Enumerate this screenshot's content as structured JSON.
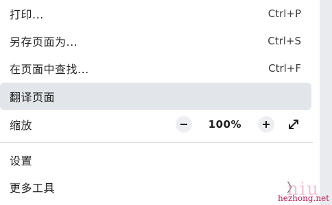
{
  "menu": {
    "print": {
      "label": "打印...",
      "shortcut": "Ctrl+P"
    },
    "save_as": {
      "label": "另存页面为...",
      "shortcut": "Ctrl+S"
    },
    "find": {
      "label": "在页面中查找...",
      "shortcut": "Ctrl+F"
    },
    "translate": {
      "label": "翻译页面"
    },
    "zoom": {
      "label": "缩放",
      "out": "−",
      "value": "100%",
      "in": "+"
    },
    "settings": {
      "label": "设置"
    },
    "more_tools": {
      "label": "更多工具",
      "chevron": "〉"
    }
  },
  "watermark": {
    "big": "niu",
    "small": "hezhong.net"
  },
  "icons": {
    "zoom_out": "minus-icon",
    "zoom_in": "plus-icon",
    "fullscreen": "fullscreen-icon",
    "submenu": "chevron-right-icon"
  },
  "colors": {
    "highlight": "#e2e5ea",
    "divider": "#dadce0",
    "scrollbar_track": "#e9ebee",
    "watermark": "#c2185b"
  }
}
